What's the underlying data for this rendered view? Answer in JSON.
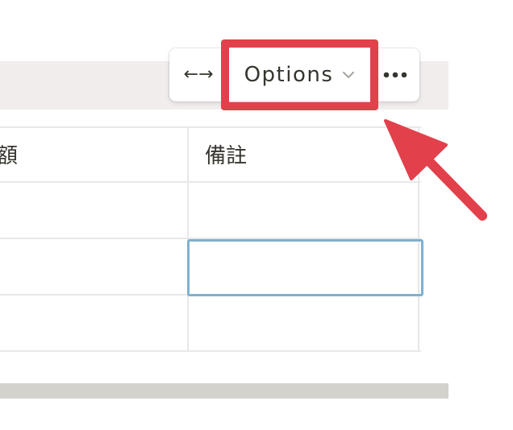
{
  "table": {
    "columns": [
      {
        "label": "額"
      },
      {
        "label": "備註"
      }
    ],
    "rows": [
      {
        "c1": "",
        "c2": ""
      },
      {
        "c1": "",
        "c2": ""
      },
      {
        "c1": "",
        "c2": ""
      }
    ]
  },
  "toolbar": {
    "resize_label": "←→",
    "options_label": "Options",
    "options_icon": "chevron-down-icon",
    "more_icon": "more-horizontal-icon"
  },
  "annotation": {
    "highlight_color": "#e2404b",
    "arrow_color": "#e2404b"
  },
  "colors": {
    "header_band": "#f1eded",
    "selected_cell_border": "#80b0cc",
    "scrollbar": "#d3d2cd"
  }
}
